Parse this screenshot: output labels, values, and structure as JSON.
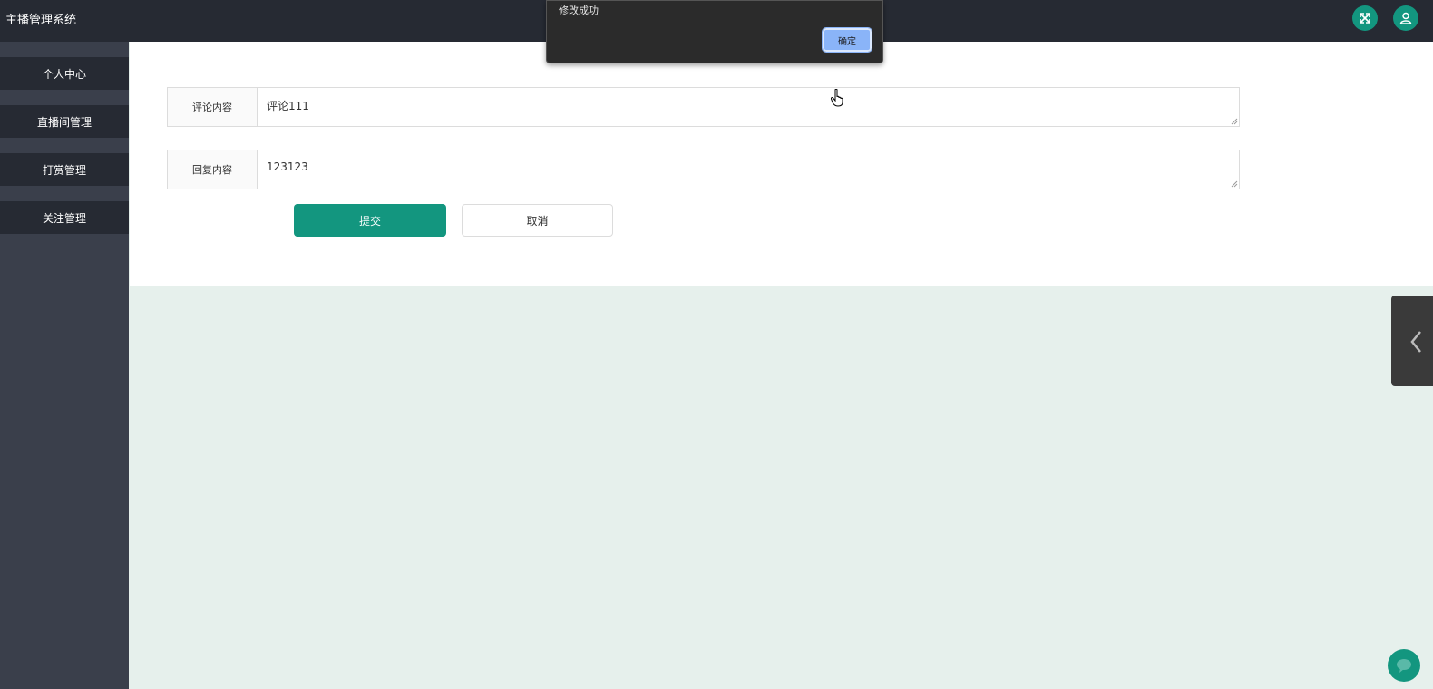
{
  "header": {
    "app_title": "主播管理系统",
    "fullscreen_icon": "fullscreen-icon",
    "user_icon": "user-icon",
    "accent_color": "#13967f"
  },
  "sidebar": {
    "items": [
      {
        "label": "个人中心"
      },
      {
        "label": "直播间管理"
      },
      {
        "label": "打赏管理"
      },
      {
        "label": "关注管理"
      }
    ]
  },
  "form": {
    "fields": [
      {
        "label": "评论内容",
        "value": "评论111"
      },
      {
        "label": "回复内容",
        "value": "123123"
      }
    ],
    "submit_label": "提交",
    "cancel_label": "取消"
  },
  "alert": {
    "message": "修改成功",
    "ok_label": "确定"
  },
  "widgets": {
    "collapse_icon": "chevron-left-icon",
    "chat_icon": "chat-icon"
  }
}
